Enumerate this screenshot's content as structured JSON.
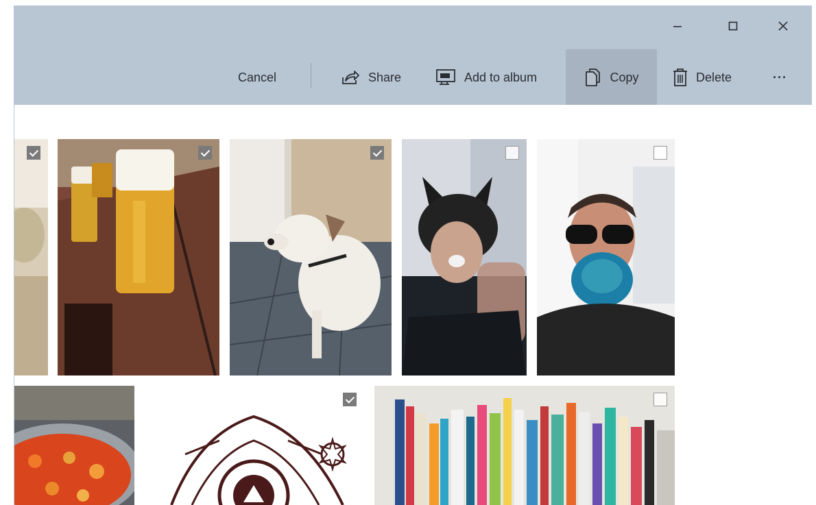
{
  "window": {
    "controls": [
      "minimize",
      "maximize",
      "close"
    ]
  },
  "toolbar": {
    "cancel_label": "Cancel",
    "share_label": "Share",
    "add_to_album_label": "Add to album",
    "copy_label": "Copy",
    "delete_label": "Delete",
    "more_label": "···"
  },
  "photos": [
    {
      "subject": "partial photo",
      "selected": true
    },
    {
      "subject": "beer glasses",
      "selected": true
    },
    {
      "subject": "white dog",
      "selected": true
    },
    {
      "subject": "wolf mask selfie",
      "selected": false
    },
    {
      "subject": "glitter beard selfie",
      "selected": false
    },
    {
      "subject": "cooking pot",
      "selected": false
    },
    {
      "subject": "celtic art",
      "selected": true
    },
    {
      "subject": "bookshelf",
      "selected": false
    }
  ],
  "colors": {
    "titlebar": "#b8c5d3",
    "active_button": "#a7b3c1",
    "selection_border": "#6c6c6c"
  }
}
